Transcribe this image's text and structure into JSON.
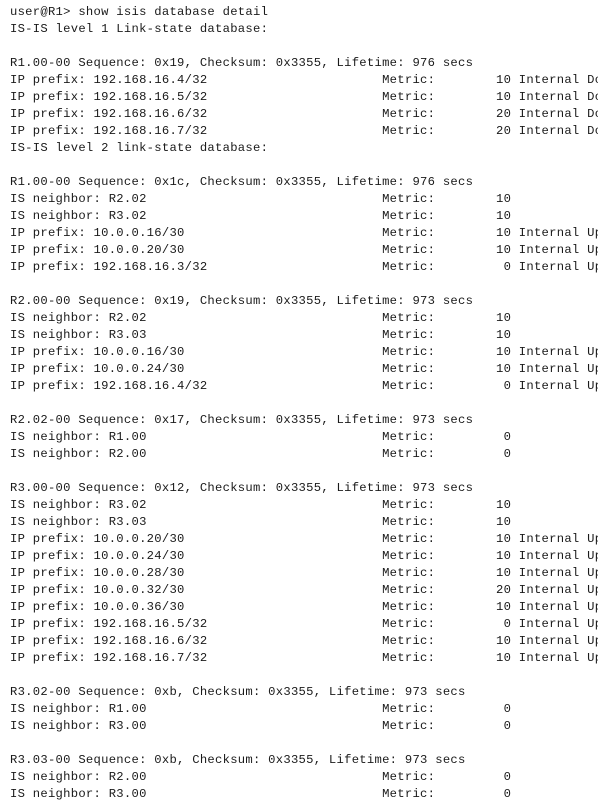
{
  "terminal": {
    "prompt": "user@R1>",
    "command": "show isis database detail",
    "prompt_line": "user@R1> show isis database detail",
    "colors": {
      "background": "#ffffff",
      "text": "#1a1a1a"
    },
    "layout": {
      "metric_column": 49,
      "metric_label": "Metric:",
      "metric_value_right_column": 66,
      "flag_column": 68
    },
    "databases": [
      {
        "heading": "IS-IS level 1 Link-state database:",
        "lsps": [
          {
            "header": "R1.00-00 Sequence: 0x19, Checksum: 0x3355, Lifetime: 976 secs",
            "lsp_id": "R1.00-00",
            "sequence": "0x19",
            "checksum": "0x3355",
            "lifetime": "976 secs",
            "entries": [
              {
                "type": "IP prefix:",
                "value": "192.168.16.4/32",
                "metric_label": "Metric:",
                "metric": "10",
                "flags": "Internal Down"
              },
              {
                "type": "IP prefix:",
                "value": "192.168.16.5/32",
                "metric_label": "Metric:",
                "metric": "10",
                "flags": "Internal Down"
              },
              {
                "type": "IP prefix:",
                "value": "192.168.16.6/32",
                "metric_label": "Metric:",
                "metric": "20",
                "flags": "Internal Down"
              },
              {
                "type": "IP prefix:",
                "value": "192.168.16.7/32",
                "metric_label": "Metric:",
                "metric": "20",
                "flags": "Internal Down"
              }
            ]
          }
        ]
      },
      {
        "heading": "IS-IS level 2 link-state database:",
        "lsps": [
          {
            "header": "R1.00-00 Sequence: 0x1c, Checksum: 0x3355, Lifetime: 976 secs",
            "lsp_id": "R1.00-00",
            "sequence": "0x1c",
            "checksum": "0x3355",
            "lifetime": "976 secs",
            "entries": [
              {
                "type": "IS neighbor:",
                "value": "R2.02",
                "metric_label": "Metric:",
                "metric": "10",
                "flags": ""
              },
              {
                "type": "IS neighbor:",
                "value": "R3.02",
                "metric_label": "Metric:",
                "metric": "10",
                "flags": ""
              },
              {
                "type": "IP prefix:",
                "value": "10.0.0.16/30",
                "metric_label": "Metric:",
                "metric": "10",
                "flags": "Internal Up"
              },
              {
                "type": "IP prefix:",
                "value": "10.0.0.20/30",
                "metric_label": "Metric:",
                "metric": "10",
                "flags": "Internal Up"
              },
              {
                "type": "IP prefix:",
                "value": "192.168.16.3/32",
                "metric_label": "Metric:",
                "metric": "0",
                "flags": "Internal Up"
              }
            ]
          },
          {
            "header": "R2.00-00 Sequence: 0x19, Checksum: 0x3355, Lifetime: 973 secs",
            "lsp_id": "R2.00-00",
            "sequence": "0x19",
            "checksum": "0x3355",
            "lifetime": "973 secs",
            "entries": [
              {
                "type": "IS neighbor:",
                "value": "R2.02",
                "metric_label": "Metric:",
                "metric": "10",
                "flags": ""
              },
              {
                "type": "IS neighbor:",
                "value": "R3.03",
                "metric_label": "Metric:",
                "metric": "10",
                "flags": ""
              },
              {
                "type": "IP prefix:",
                "value": "10.0.0.16/30",
                "metric_label": "Metric:",
                "metric": "10",
                "flags": "Internal Up"
              },
              {
                "type": "IP prefix:",
                "value": "10.0.0.24/30",
                "metric_label": "Metric:",
                "metric": "10",
                "flags": "Internal Up"
              },
              {
                "type": "IP prefix:",
                "value": "192.168.16.4/32",
                "metric_label": "Metric:",
                "metric": "0",
                "flags": "Internal Up"
              }
            ]
          },
          {
            "header": "R2.02-00 Sequence: 0x17, Checksum: 0x3355, Lifetime: 973 secs",
            "lsp_id": "R2.02-00",
            "sequence": "0x17",
            "checksum": "0x3355",
            "lifetime": "973 secs",
            "entries": [
              {
                "type": "IS neighbor:",
                "value": "R1.00",
                "metric_label": "Metric:",
                "metric": "0",
                "flags": ""
              },
              {
                "type": "IS neighbor:",
                "value": "R2.00",
                "metric_label": "Metric:",
                "metric": "0",
                "flags": ""
              }
            ]
          },
          {
            "header": "R3.00-00 Sequence: 0x12, Checksum: 0x3355, Lifetime: 973 secs",
            "lsp_id": "R3.00-00",
            "sequence": "0x12",
            "checksum": "0x3355",
            "lifetime": "973 secs",
            "entries": [
              {
                "type": "IS neighbor:",
                "value": "R3.02",
                "metric_label": "Metric:",
                "metric": "10",
                "flags": ""
              },
              {
                "type": "IS neighbor:",
                "value": "R3.03",
                "metric_label": "Metric:",
                "metric": "10",
                "flags": ""
              },
              {
                "type": "IP prefix:",
                "value": "10.0.0.20/30",
                "metric_label": "Metric:",
                "metric": "10",
                "flags": "Internal Up"
              },
              {
                "type": "IP prefix:",
                "value": "10.0.0.24/30",
                "metric_label": "Metric:",
                "metric": "10",
                "flags": "Internal Up"
              },
              {
                "type": "IP prefix:",
                "value": "10.0.0.28/30",
                "metric_label": "Metric:",
                "metric": "10",
                "flags": "Internal Up"
              },
              {
                "type": "IP prefix:",
                "value": "10.0.0.32/30",
                "metric_label": "Metric:",
                "metric": "20",
                "flags": "Internal Up"
              },
              {
                "type": "IP prefix:",
                "value": "10.0.0.36/30",
                "metric_label": "Metric:",
                "metric": "10",
                "flags": "Internal Up"
              },
              {
                "type": "IP prefix:",
                "value": "192.168.16.5/32",
                "metric_label": "Metric:",
                "metric": "0",
                "flags": "Internal Up"
              },
              {
                "type": "IP prefix:",
                "value": "192.168.16.6/32",
                "metric_label": "Metric:",
                "metric": "10",
                "flags": "Internal Up"
              },
              {
                "type": "IP prefix:",
                "value": "192.168.16.7/32",
                "metric_label": "Metric:",
                "metric": "10",
                "flags": "Internal Up"
              }
            ]
          },
          {
            "header": "R3.02-00 Sequence: 0xb, Checksum: 0x3355, Lifetime: 973 secs",
            "lsp_id": "R3.02-00",
            "sequence": "0xb",
            "checksum": "0x3355",
            "lifetime": "973 secs",
            "entries": [
              {
                "type": "IS neighbor:",
                "value": "R1.00",
                "metric_label": "Metric:",
                "metric": "0",
                "flags": ""
              },
              {
                "type": "IS neighbor:",
                "value": "R3.00",
                "metric_label": "Metric:",
                "metric": "0",
                "flags": ""
              }
            ]
          },
          {
            "header": "R3.03-00 Sequence: 0xb, Checksum: 0x3355, Lifetime: 973 secs",
            "lsp_id": "R3.03-00",
            "sequence": "0xb",
            "checksum": "0x3355",
            "lifetime": "973 secs",
            "entries": [
              {
                "type": "IS neighbor:",
                "value": "R2.00",
                "metric_label": "Metric:",
                "metric": "0",
                "flags": ""
              },
              {
                "type": "IS neighbor:",
                "value": "R3.00",
                "metric_label": "Metric:",
                "metric": "0",
                "flags": ""
              }
            ]
          }
        ]
      }
    ]
  }
}
